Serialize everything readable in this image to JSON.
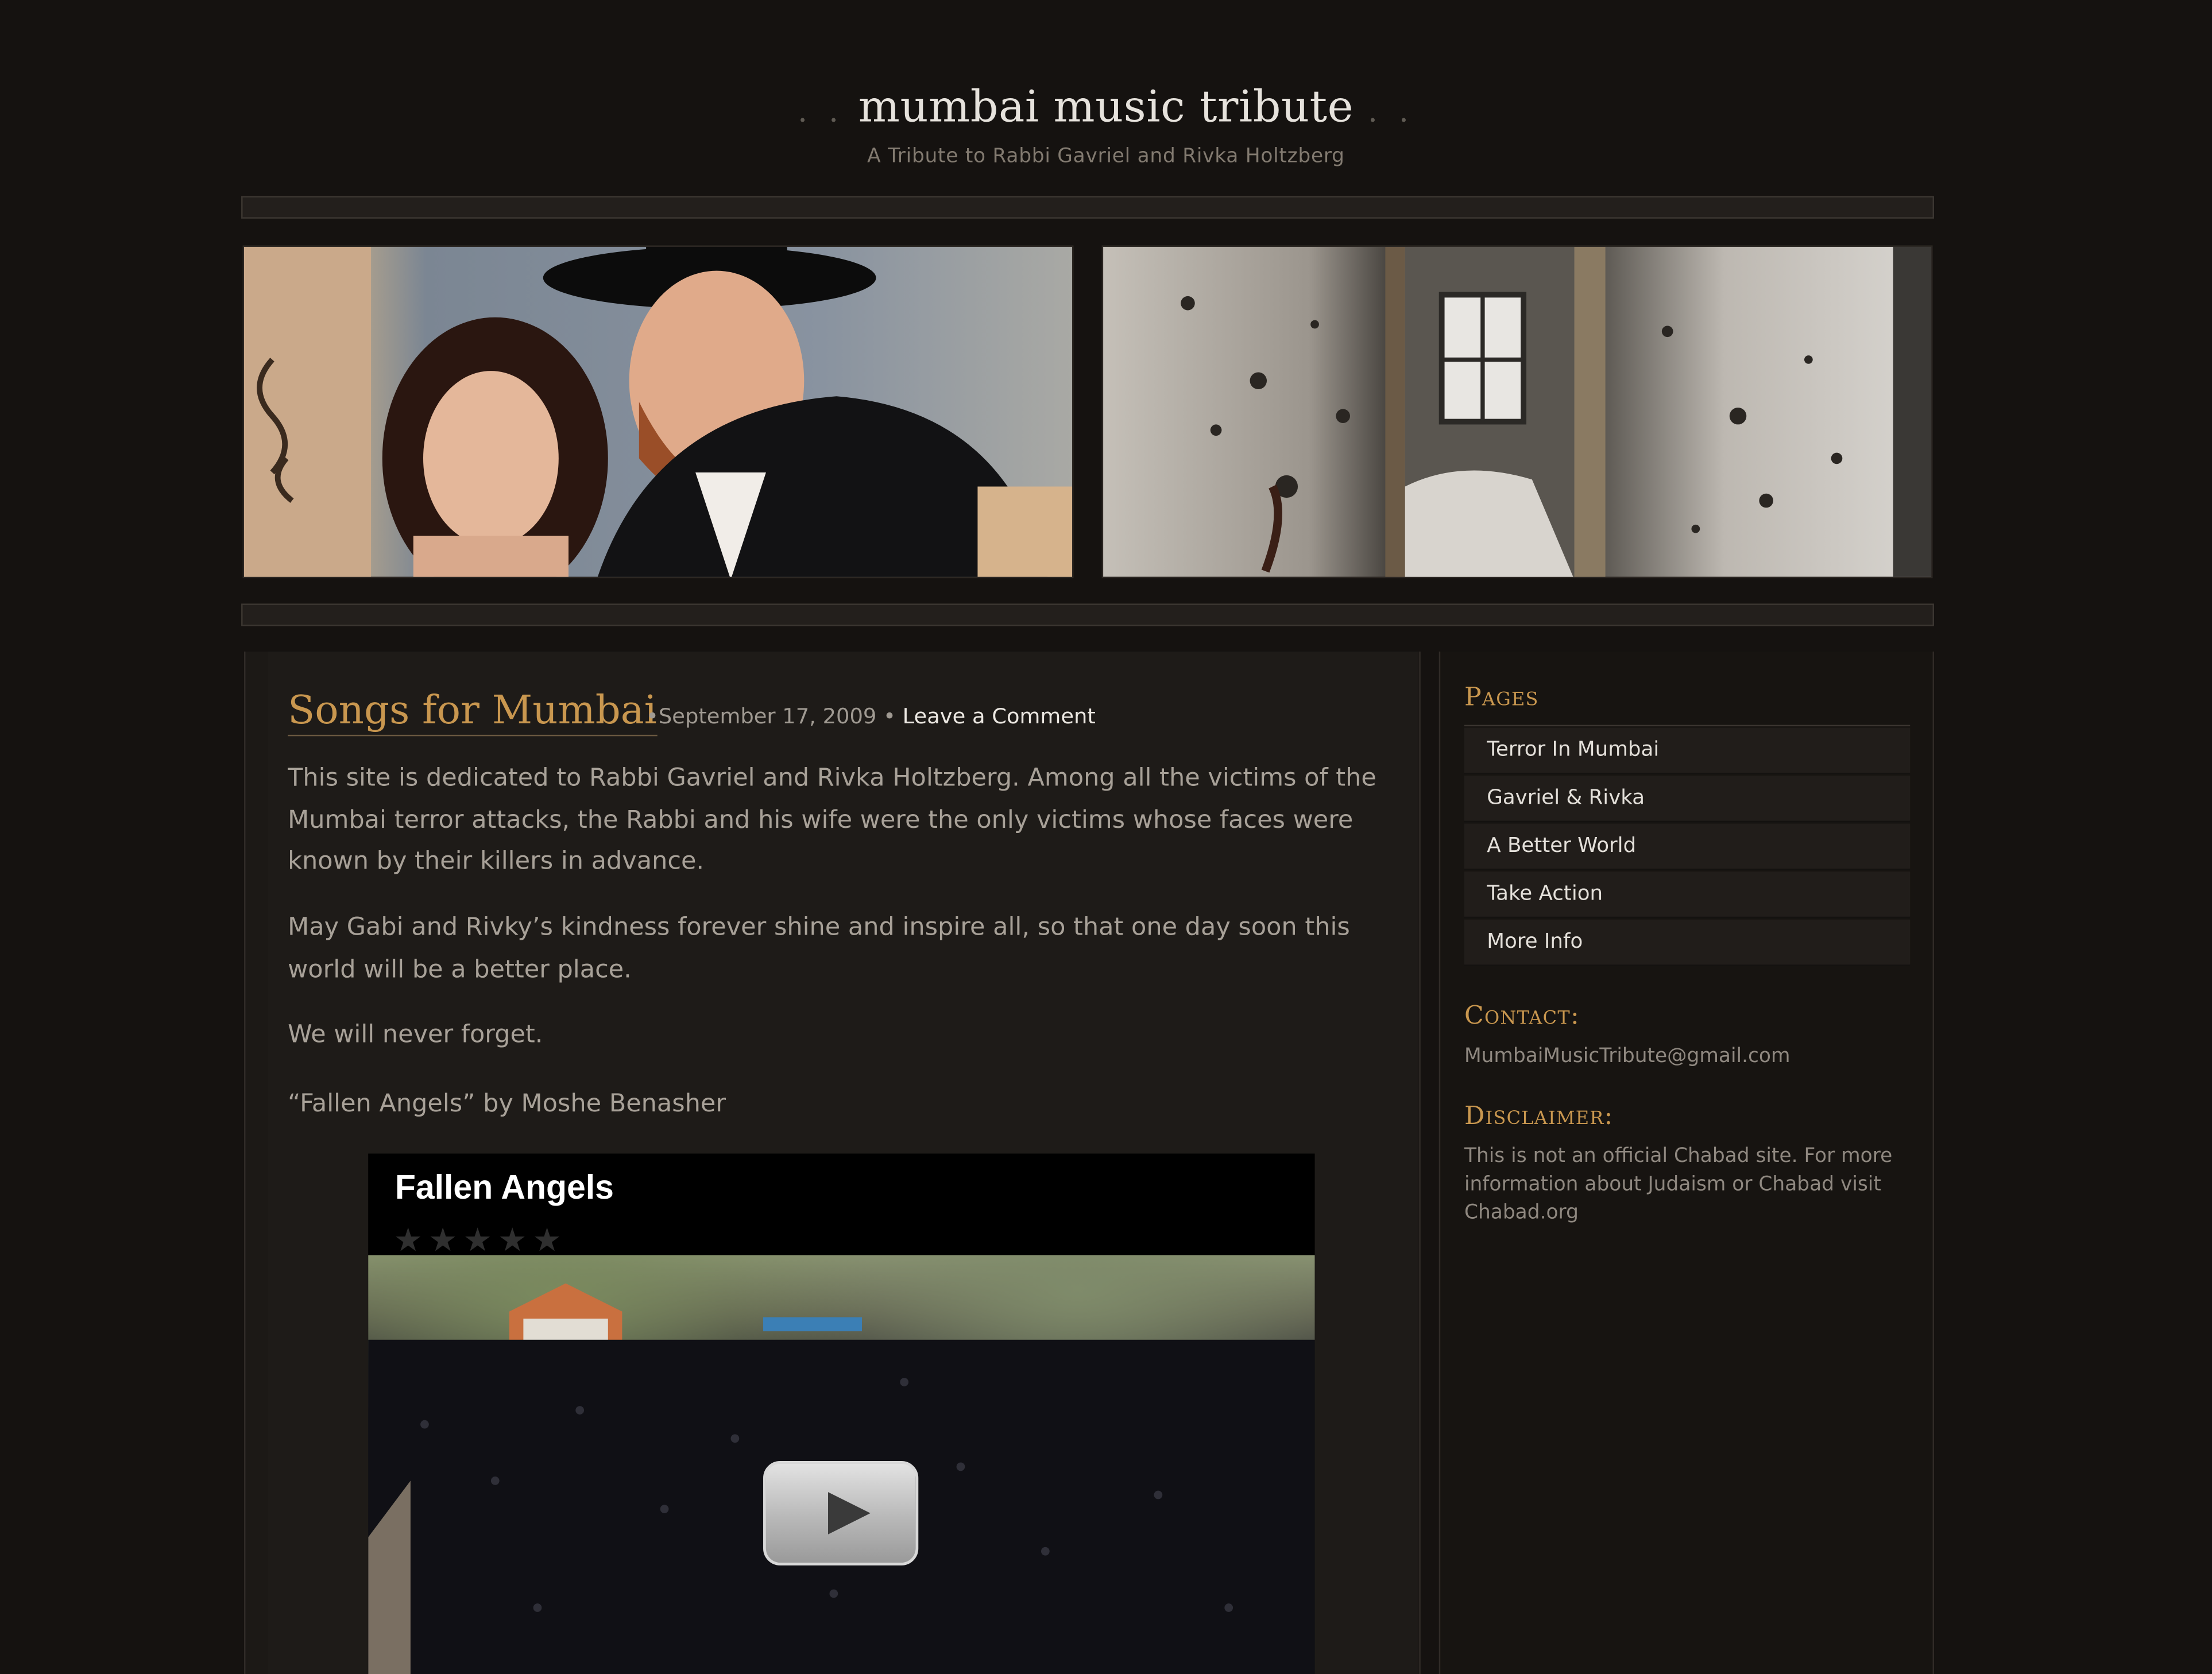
{
  "header": {
    "title_dots_left": ". .",
    "title": "mumbai music tribute",
    "title_dots_right": ". .",
    "tagline": "A Tribute to Rabbi Gavriel and Rivka Holtzberg"
  },
  "post": {
    "title": "Songs for Mumbai",
    "meta_separator": "•",
    "date": "September 17, 2009",
    "comment_link": "Leave a Comment",
    "paragraphs": [
      "This site is dedicated to Rabbi Gavriel and Rivka Holtzberg. Among all the victims of the Mumbai terror attacks, the Rabbi and his wife were the only victims whose faces were known by their killers in advance.",
      "May Gabi and Rivky’s kindness forever shine and inspire all, so that one day soon this world will be a better place.",
      "We will never forget.",
      "“Fallen Angels” by Moshe Benasher"
    ]
  },
  "video": {
    "title": "Fallen Angels",
    "stars": "★★★★★",
    "rating_filled": 0,
    "rating_max": 5
  },
  "sidebar": {
    "pages_heading": "Pages",
    "pages": [
      "Terror In Mumbai",
      "Gavriel & Rivka",
      "A Better World",
      "Take Action",
      "More Info"
    ],
    "contact_heading": "Contact:",
    "contact_email": "MumbaiMusicTribute@gmail.com",
    "disclaimer_heading": "Disclaimer:",
    "disclaimer_lines": [
      "This is not an official Chabad site. For more",
      "information about Judaism or Chabad visit",
      "Chabad.org"
    ]
  },
  "colors": {
    "background": "#151210",
    "accent": "#c9974f",
    "link": "#ece8e2"
  }
}
